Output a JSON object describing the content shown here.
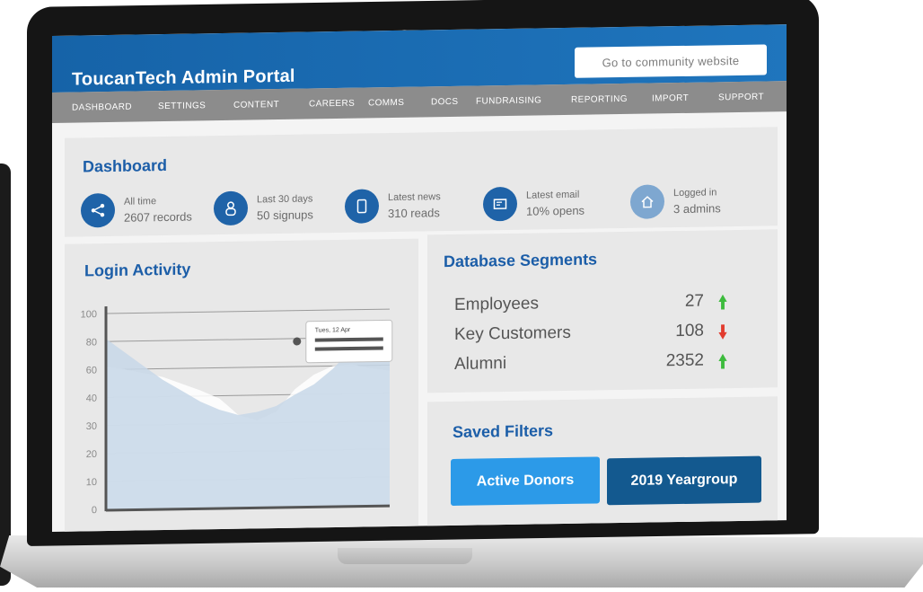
{
  "app": {
    "title": "ToucanTech Admin Portal",
    "community_button": "Go to community website"
  },
  "nav": [
    "Dashboard",
    "Settings",
    "Content",
    "Careers",
    "Comms",
    "Docs",
    "Fundraising",
    "Reporting",
    "Import",
    "Support"
  ],
  "dashboard": {
    "title": "Dashboard",
    "stats": [
      {
        "icon": "share-icon",
        "line1": "All time",
        "line2": "2607 records"
      },
      {
        "icon": "user-icon",
        "line1": "Last 30 days",
        "line2": "50 signups"
      },
      {
        "icon": "phone-icon",
        "line1": "Latest news",
        "line2": "310 reads"
      },
      {
        "icon": "email-icon",
        "line1": "Latest email",
        "line2": "10% opens"
      },
      {
        "icon": "home-icon",
        "line1": "Logged in",
        "line2": "3 admins"
      }
    ]
  },
  "login_activity": {
    "title": "Login Activity",
    "tooltip_date": "Tues, 12 Apr"
  },
  "chart_data": {
    "type": "area",
    "title": "Login Activity",
    "xlabel": "",
    "ylabel": "",
    "ylim": [
      0,
      100
    ],
    "yticks": [
      0,
      10,
      20,
      30,
      40,
      60,
      80,
      100
    ],
    "grid": true,
    "series": [
      {
        "values": [
          62,
          60,
          57,
          54,
          49,
          44,
          39,
          33,
          31,
          34,
          44,
          54,
          60,
          61,
          58,
          56
        ]
      },
      {
        "values": [
          82,
          72,
          62,
          52,
          44,
          38,
          35,
          33,
          34,
          36,
          40,
          47,
          58,
          72,
          75,
          75
        ]
      }
    ],
    "highlight": {
      "point_index": 12,
      "value": 78,
      "tooltip": "Tues, 12 Apr"
    }
  },
  "segments": {
    "title": "Database Segments",
    "rows": [
      {
        "name": "Employees",
        "value": "27",
        "trend": "up"
      },
      {
        "name": "Key Customers",
        "value": "108",
        "trend": "down"
      },
      {
        "name": "Alumni",
        "value": "2352",
        "trend": "up"
      }
    ]
  },
  "filters": {
    "title": "Saved Filters",
    "items": [
      "Active Donors",
      "2019 Yeargroup"
    ]
  },
  "colors": {
    "primary": "#1f63a8",
    "accent": "#2c9ae8",
    "up": "#3dbb3d",
    "down": "#e23b2e",
    "nav": "#8c8c8c"
  }
}
